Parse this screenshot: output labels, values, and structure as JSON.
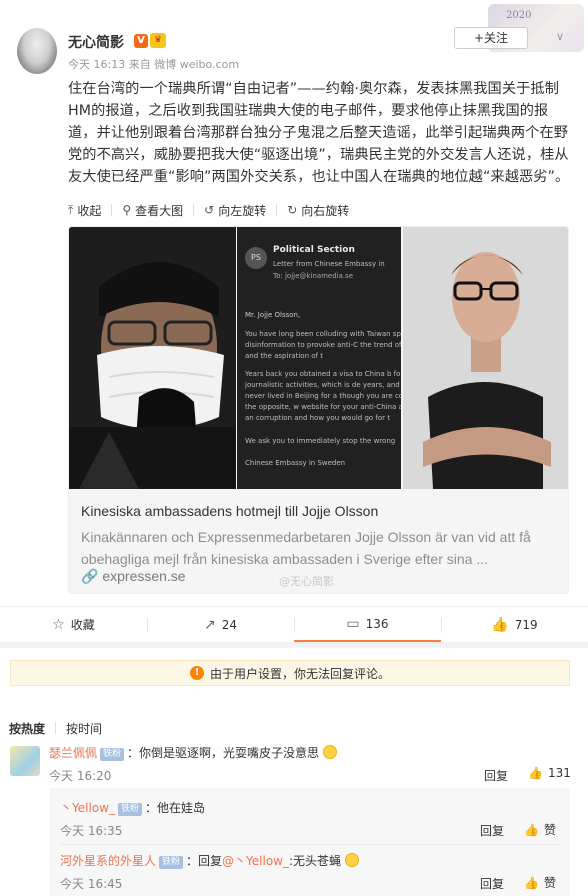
{
  "post": {
    "username": "无心简影",
    "verified_badge": "V",
    "time": "今天 16:13",
    "source_prefix": "来自",
    "source": "微博 weibo.com",
    "follow_label": "+关注",
    "deco_text": "2020",
    "text": "住在台湾的一个瑞典所谓“自由记者”——约翰·奥尔森，发表抹黑我国关于抵制HM的报道，之后收到我国驻瑞典大使的电子邮件，要求他停止抹黑我国的报道，并让他别跟着台湾那群台独分子鬼混之后整天造谣，此举引起瑞典两个在野党的不高兴，威胁要把我大使“驱逐出境”，瑞典民主党的外交发言人还说，桂从友大使已经严重“影响”两国外交关系，也让中国人在瑞典的地位越“来越恶劣”。"
  },
  "image_tools": [
    {
      "icon": "collapse-icon",
      "label": "收起"
    },
    {
      "icon": "search-icon",
      "label": "查看大图"
    },
    {
      "icon": "rotate-left-icon",
      "label": "向左旋转"
    },
    {
      "icon": "rotate-right-icon",
      "label": "向右旋转"
    }
  ],
  "email": {
    "avatar": "PS",
    "sender": "Political Section",
    "subject": "Letter from Chinese Embassy in",
    "to_label": "To:",
    "to": "jojje@kinamedia.se",
    "greeting": "Mr. Jojje Olsson,",
    "p1": "You have long been colluding with Taiwan spreading disinformation to provoke anti-C the trend of history and the aspiration of t",
    "p2": "Years back you obtained a visa to China b for illegal journalistic activities, which is de years, and you never lived in Beijing for a though you are completely the opposite, w website for your anti-China articles, in an corruption and how you would go for t",
    "p3": "We ask you to immediately stop the wrong",
    "sign": "Chinese Embassy in Sweden"
  },
  "link_card": {
    "title": "Kinesiska ambassadens hotmejl till Jojje Olsson",
    "description": "Kinakännaren och Expressenmedarbetaren Jojje Olsson är van vid att få obehagliga mejl från kinesiska ambassaden i Sverige efter sina ...",
    "source": "expressen.se",
    "watermark": "@无心简影"
  },
  "actions": {
    "favorite": "收藏",
    "repost": "24",
    "comment": "136",
    "like": "719"
  },
  "notice": "由于用户设置，你无法回复评论。",
  "sort": {
    "hot": "按热度",
    "time": "按时间"
  },
  "comments": [
    {
      "name": "瑟兰佩佩",
      "badge": "铁粉",
      "text": "：你倒是驱逐啊，光耍嘴皮子没意思",
      "time": "今天 16:20",
      "reply": "回复",
      "likes": "131"
    }
  ],
  "replies": [
    {
      "name": "丶Yellow_",
      "badge": "铁粉",
      "text": "：他在娃岛",
      "time": "今天 16:35",
      "reply": "回复",
      "like": "赞"
    },
    {
      "name": "河外星系的外星人",
      "badge": "铁粉",
      "reply_prefix": "：回复",
      "mention": "@丶Yellow_",
      "text": ":无头苍蝇",
      "time": "今天 16:45",
      "reply": "回复",
      "like": "赞"
    }
  ]
}
